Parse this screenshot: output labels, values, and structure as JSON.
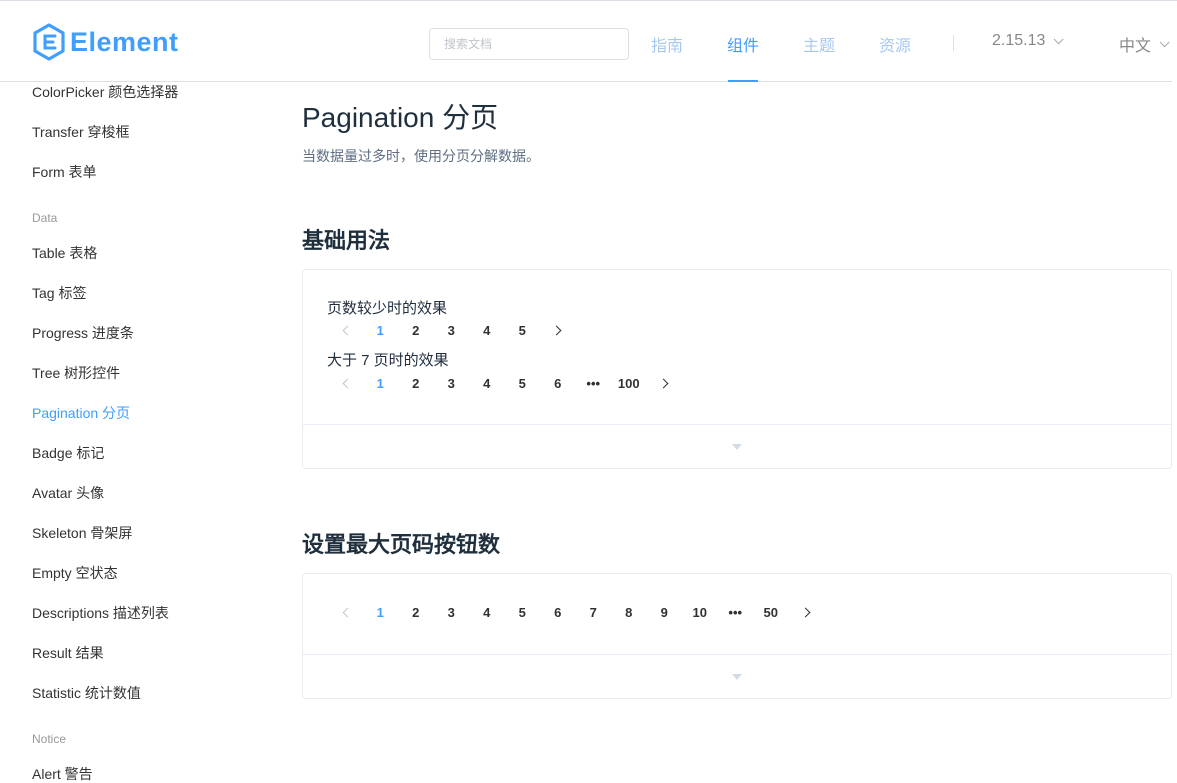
{
  "header": {
    "logo_text": "Element",
    "search_placeholder": "搜索文档",
    "nav": [
      "指南",
      "组件",
      "主题",
      "资源"
    ],
    "version": "2.15.13",
    "language": "中文"
  },
  "sidebar": {
    "items_top": [
      "ColorPicker 颜色选择器",
      "Transfer 穿梭框",
      "Form 表单"
    ],
    "group_data": "Data",
    "items_data": [
      "Table 表格",
      "Tag 标签",
      "Progress 进度条",
      "Tree 树形控件",
      "Pagination 分页",
      "Badge 标记",
      "Avatar 头像",
      "Skeleton 骨架屏",
      "Empty 空状态",
      "Descriptions 描述列表",
      "Result 结果",
      "Statistic 统计数值"
    ],
    "group_notice": "Notice",
    "items_notice": [
      "Alert 警告"
    ]
  },
  "main": {
    "title": "Pagination 分页",
    "description": "当数据量过多时，使用分页分解数据。",
    "section1": {
      "title": "基础用法",
      "demo1_label": "页数较少时的效果",
      "demo1_pages": [
        "1",
        "2",
        "3",
        "4",
        "5"
      ],
      "demo2_label": "大于 7 页时的效果",
      "demo2_pages": [
        "1",
        "2",
        "3",
        "4",
        "5",
        "6",
        "•••",
        "100"
      ]
    },
    "section2": {
      "title": "设置最大页码按钮数",
      "pages": [
        "1",
        "2",
        "3",
        "4",
        "5",
        "6",
        "7",
        "8",
        "9",
        "10",
        "•••",
        "50"
      ]
    }
  },
  "colors": {
    "accent": "#409eff",
    "nav_inactive": "#a6c8f0"
  }
}
